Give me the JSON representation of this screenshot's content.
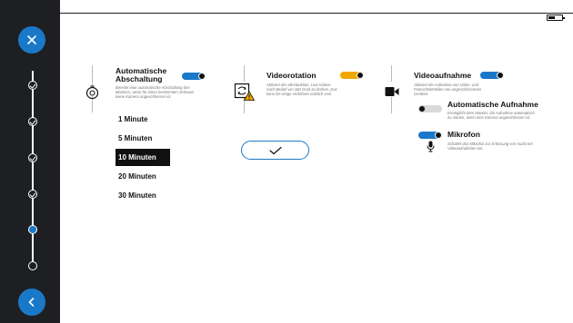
{
  "sidebar": {
    "close_icon": "close-icon",
    "back_icon": "chevron-left-icon",
    "steps": [
      "done",
      "done",
      "done",
      "done",
      "current",
      "pending"
    ]
  },
  "status": {
    "battery_icon": "battery-icon"
  },
  "auto_shutdown": {
    "title": "Automatische Abschaltung",
    "description": "Bereitet eine automatische Abschaltung des Monitors, wenn für einen bestimmten Zeitraum keine Kamera angeschlossen ist.",
    "toggle": "on",
    "icon": "timer-icon",
    "options": [
      "1 Minute",
      "5 Minuten",
      "10 Minuten",
      "20 Minuten",
      "30 Minuten"
    ],
    "selected": "10 Minuten"
  },
  "video_rotation": {
    "title": "Videorotation",
    "description": "Aktiviert die Allesfunktion, Live-Videos nach Bedarf um 180 Grad zu drehen. Das kann für einige Verfahren nützlich sein.",
    "toggle": "on",
    "icon": "rotate-warning-icon"
  },
  "confirm": {
    "icon": "check-icon"
  },
  "video_recording": {
    "title": "Videoaufnahme",
    "description": "Aktiviert die Aufnahme von Video- und Fotoschnittstellen von angeschlossenen Geräten.",
    "toggle": "on",
    "icon": "video-camera-icon",
    "auto_recording": {
      "title": "Automatische Aufnahme",
      "description": "Ermöglicht dem Monitor, die Aufnahme automatisch zu starten, wenn eine Kamera angeschlossen ist.",
      "toggle": "off"
    },
    "microphone": {
      "title": "Mikrofon",
      "description": "Schaltet das Mikrofon zur Erfassung von Audio bei Videoaufnahmen ein.",
      "toggle": "on",
      "icon": "microphone-icon"
    }
  },
  "colors": {
    "accent": "#1a78c9",
    "warning": "#f0a800",
    "sidebar": "#1e1f22"
  }
}
